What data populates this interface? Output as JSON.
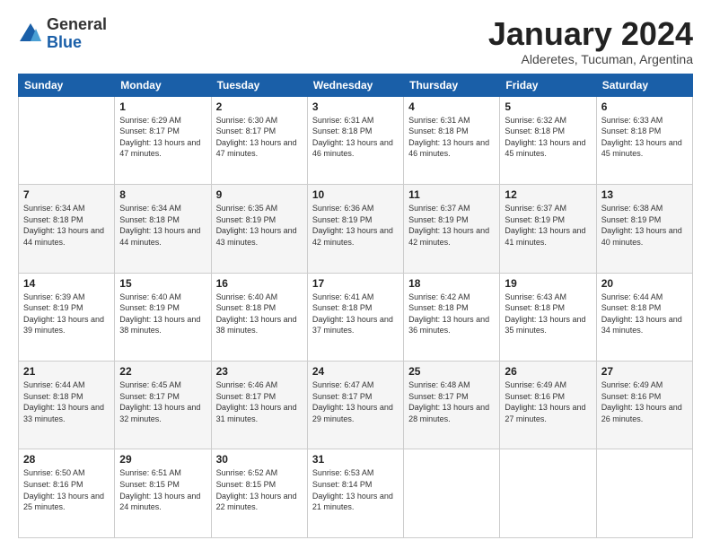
{
  "logo": {
    "general": "General",
    "blue": "Blue"
  },
  "header": {
    "month": "January 2024",
    "location": "Alderetes, Tucuman, Argentina"
  },
  "weekdays": [
    "Sunday",
    "Monday",
    "Tuesday",
    "Wednesday",
    "Thursday",
    "Friday",
    "Saturday"
  ],
  "weeks": [
    [
      {
        "day": "",
        "sunrise": "",
        "sunset": "",
        "daylight": ""
      },
      {
        "day": "1",
        "sunrise": "Sunrise: 6:29 AM",
        "sunset": "Sunset: 8:17 PM",
        "daylight": "Daylight: 13 hours and 47 minutes."
      },
      {
        "day": "2",
        "sunrise": "Sunrise: 6:30 AM",
        "sunset": "Sunset: 8:17 PM",
        "daylight": "Daylight: 13 hours and 47 minutes."
      },
      {
        "day": "3",
        "sunrise": "Sunrise: 6:31 AM",
        "sunset": "Sunset: 8:18 PM",
        "daylight": "Daylight: 13 hours and 46 minutes."
      },
      {
        "day": "4",
        "sunrise": "Sunrise: 6:31 AM",
        "sunset": "Sunset: 8:18 PM",
        "daylight": "Daylight: 13 hours and 46 minutes."
      },
      {
        "day": "5",
        "sunrise": "Sunrise: 6:32 AM",
        "sunset": "Sunset: 8:18 PM",
        "daylight": "Daylight: 13 hours and 45 minutes."
      },
      {
        "day": "6",
        "sunrise": "Sunrise: 6:33 AM",
        "sunset": "Sunset: 8:18 PM",
        "daylight": "Daylight: 13 hours and 45 minutes."
      }
    ],
    [
      {
        "day": "7",
        "sunrise": "Sunrise: 6:34 AM",
        "sunset": "Sunset: 8:18 PM",
        "daylight": "Daylight: 13 hours and 44 minutes."
      },
      {
        "day": "8",
        "sunrise": "Sunrise: 6:34 AM",
        "sunset": "Sunset: 8:18 PM",
        "daylight": "Daylight: 13 hours and 44 minutes."
      },
      {
        "day": "9",
        "sunrise": "Sunrise: 6:35 AM",
        "sunset": "Sunset: 8:19 PM",
        "daylight": "Daylight: 13 hours and 43 minutes."
      },
      {
        "day": "10",
        "sunrise": "Sunrise: 6:36 AM",
        "sunset": "Sunset: 8:19 PM",
        "daylight": "Daylight: 13 hours and 42 minutes."
      },
      {
        "day": "11",
        "sunrise": "Sunrise: 6:37 AM",
        "sunset": "Sunset: 8:19 PM",
        "daylight": "Daylight: 13 hours and 42 minutes."
      },
      {
        "day": "12",
        "sunrise": "Sunrise: 6:37 AM",
        "sunset": "Sunset: 8:19 PM",
        "daylight": "Daylight: 13 hours and 41 minutes."
      },
      {
        "day": "13",
        "sunrise": "Sunrise: 6:38 AM",
        "sunset": "Sunset: 8:19 PM",
        "daylight": "Daylight: 13 hours and 40 minutes."
      }
    ],
    [
      {
        "day": "14",
        "sunrise": "Sunrise: 6:39 AM",
        "sunset": "Sunset: 8:19 PM",
        "daylight": "Daylight: 13 hours and 39 minutes."
      },
      {
        "day": "15",
        "sunrise": "Sunrise: 6:40 AM",
        "sunset": "Sunset: 8:19 PM",
        "daylight": "Daylight: 13 hours and 38 minutes."
      },
      {
        "day": "16",
        "sunrise": "Sunrise: 6:40 AM",
        "sunset": "Sunset: 8:18 PM",
        "daylight": "Daylight: 13 hours and 38 minutes."
      },
      {
        "day": "17",
        "sunrise": "Sunrise: 6:41 AM",
        "sunset": "Sunset: 8:18 PM",
        "daylight": "Daylight: 13 hours and 37 minutes."
      },
      {
        "day": "18",
        "sunrise": "Sunrise: 6:42 AM",
        "sunset": "Sunset: 8:18 PM",
        "daylight": "Daylight: 13 hours and 36 minutes."
      },
      {
        "day": "19",
        "sunrise": "Sunrise: 6:43 AM",
        "sunset": "Sunset: 8:18 PM",
        "daylight": "Daylight: 13 hours and 35 minutes."
      },
      {
        "day": "20",
        "sunrise": "Sunrise: 6:44 AM",
        "sunset": "Sunset: 8:18 PM",
        "daylight": "Daylight: 13 hours and 34 minutes."
      }
    ],
    [
      {
        "day": "21",
        "sunrise": "Sunrise: 6:44 AM",
        "sunset": "Sunset: 8:18 PM",
        "daylight": "Daylight: 13 hours and 33 minutes."
      },
      {
        "day": "22",
        "sunrise": "Sunrise: 6:45 AM",
        "sunset": "Sunset: 8:17 PM",
        "daylight": "Daylight: 13 hours and 32 minutes."
      },
      {
        "day": "23",
        "sunrise": "Sunrise: 6:46 AM",
        "sunset": "Sunset: 8:17 PM",
        "daylight": "Daylight: 13 hours and 31 minutes."
      },
      {
        "day": "24",
        "sunrise": "Sunrise: 6:47 AM",
        "sunset": "Sunset: 8:17 PM",
        "daylight": "Daylight: 13 hours and 29 minutes."
      },
      {
        "day": "25",
        "sunrise": "Sunrise: 6:48 AM",
        "sunset": "Sunset: 8:17 PM",
        "daylight": "Daylight: 13 hours and 28 minutes."
      },
      {
        "day": "26",
        "sunrise": "Sunrise: 6:49 AM",
        "sunset": "Sunset: 8:16 PM",
        "daylight": "Daylight: 13 hours and 27 minutes."
      },
      {
        "day": "27",
        "sunrise": "Sunrise: 6:49 AM",
        "sunset": "Sunset: 8:16 PM",
        "daylight": "Daylight: 13 hours and 26 minutes."
      }
    ],
    [
      {
        "day": "28",
        "sunrise": "Sunrise: 6:50 AM",
        "sunset": "Sunset: 8:16 PM",
        "daylight": "Daylight: 13 hours and 25 minutes."
      },
      {
        "day": "29",
        "sunrise": "Sunrise: 6:51 AM",
        "sunset": "Sunset: 8:15 PM",
        "daylight": "Daylight: 13 hours and 24 minutes."
      },
      {
        "day": "30",
        "sunrise": "Sunrise: 6:52 AM",
        "sunset": "Sunset: 8:15 PM",
        "daylight": "Daylight: 13 hours and 22 minutes."
      },
      {
        "day": "31",
        "sunrise": "Sunrise: 6:53 AM",
        "sunset": "Sunset: 8:14 PM",
        "daylight": "Daylight: 13 hours and 21 minutes."
      },
      {
        "day": "",
        "sunrise": "",
        "sunset": "",
        "daylight": ""
      },
      {
        "day": "",
        "sunrise": "",
        "sunset": "",
        "daylight": ""
      },
      {
        "day": "",
        "sunrise": "",
        "sunset": "",
        "daylight": ""
      }
    ]
  ]
}
